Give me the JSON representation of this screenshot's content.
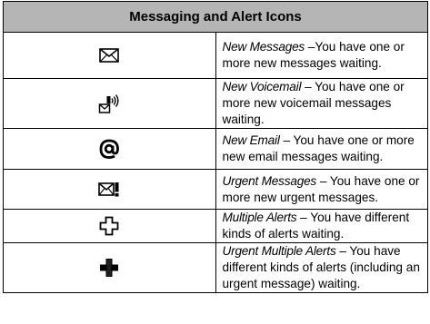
{
  "table": {
    "header": "Messaging and Alert Icons",
    "rows": [
      {
        "icon": "envelope-icon",
        "term": "New Messages",
        "sep": " –",
        "desc": "You have one or more new messages waiting."
      },
      {
        "icon": "voicemail-icon",
        "term": "New Voicemail",
        "sep": " – ",
        "desc": "You have one or more new voicemail messages waiting."
      },
      {
        "icon": "email-at-icon",
        "term": "New Email",
        "sep": " – ",
        "desc": "You have one or more new email messages waiting."
      },
      {
        "icon": "urgent-envelope-icon",
        "term": "Urgent Messages",
        "sep": " – ",
        "desc": "You have one or more new urgent messages."
      },
      {
        "icon": "multiple-alerts-icon",
        "term": "Multiple Alerts",
        "sep": " – ",
        "desc": "You have different kinds of alerts waiting."
      },
      {
        "icon": "urgent-multiple-alerts-icon",
        "term": "Urgent Multiple Alerts",
        "sep": " – ",
        "desc": "You have different kinds of alerts (including an urgent message) waiting."
      }
    ]
  }
}
